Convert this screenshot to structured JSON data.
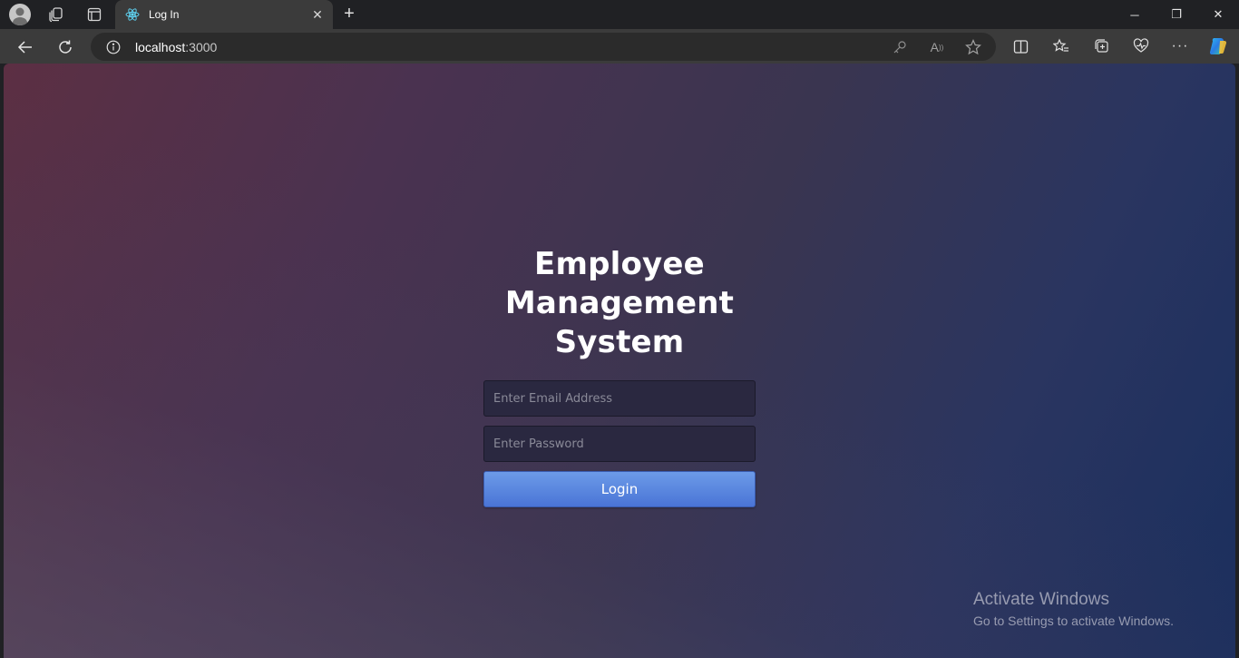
{
  "browser": {
    "tab_title": "Log In",
    "tab_favicon": "react-icon",
    "url_host": "localhost",
    "url_port": ":3000",
    "window_buttons": {
      "minimize": "─",
      "restore": "❐",
      "close": "✕"
    }
  },
  "login": {
    "title_line1": "Employee",
    "title_line2": "Management",
    "title_line3": "System",
    "email_placeholder": "Enter Email Address",
    "password_placeholder": "Enter Password",
    "button_label": "Login"
  },
  "watermark": {
    "title": "Activate Windows",
    "subtitle": "Go to Settings to activate Windows."
  },
  "colors": {
    "button": "#5a86df",
    "input_bg": "#2a2840",
    "bg_left": "#5c2f43",
    "bg_right": "#1a2f5e"
  }
}
